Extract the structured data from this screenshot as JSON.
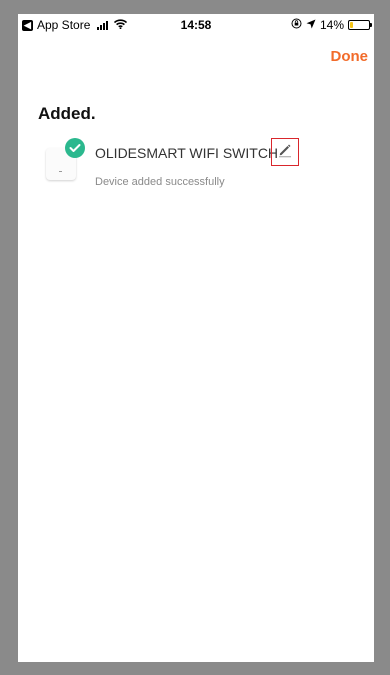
{
  "status_bar": {
    "back_app": "App Store",
    "time": "14:58",
    "battery_percent": "14%",
    "battery_level": 0.14,
    "icons": [
      "back-chevron-icon",
      "signal-icon",
      "wifi-icon",
      "orientation-lock-icon",
      "location-arrow-icon",
      "battery-icon"
    ]
  },
  "nav": {
    "done_label": "Done"
  },
  "page": {
    "title": "Added."
  },
  "device": {
    "name": "OLIDESMART WIFI SWITCH",
    "status": "Device added successfully",
    "badge_icon": "check-icon",
    "edit_icon": "pencil-icon"
  },
  "colors": {
    "accent": "#f26b2a",
    "success": "#2bb88e",
    "highlight_border": "#d9262c",
    "battery_low": "#f5c518"
  }
}
